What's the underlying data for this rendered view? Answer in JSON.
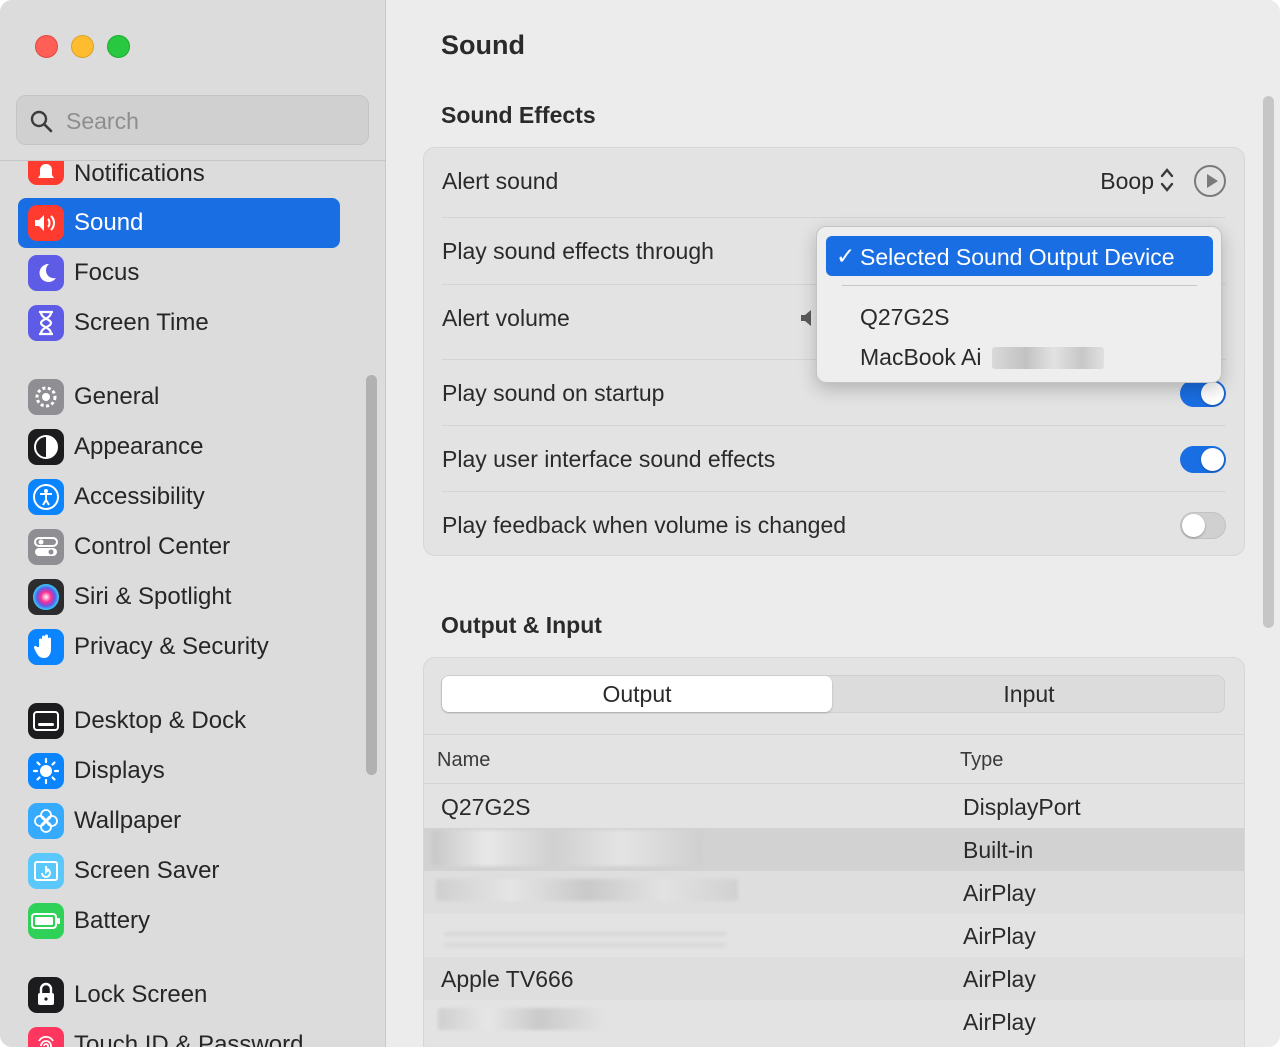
{
  "sidebar": {
    "search_placeholder": "Search",
    "items": [
      {
        "label": "Notifications",
        "icon": "bell-icon",
        "color": "#ff3b30"
      },
      {
        "label": "Sound",
        "icon": "speaker-icon",
        "color": "#ff3b30",
        "active": true
      },
      {
        "label": "Focus",
        "icon": "moon-icon",
        "color": "#5e5ce6"
      },
      {
        "label": "Screen Time",
        "icon": "hourglass-icon",
        "color": "#5e5ce6"
      },
      {
        "label": "General",
        "icon": "gear-icon",
        "color": "#8e8e93"
      },
      {
        "label": "Appearance",
        "icon": "appearance-icon",
        "color": "#1c1c1e"
      },
      {
        "label": "Accessibility",
        "icon": "accessibility-icon",
        "color": "#0a84ff"
      },
      {
        "label": "Control Center",
        "icon": "toggles-icon",
        "color": "#8e8e93"
      },
      {
        "label": "Siri & Spotlight",
        "icon": "siri-icon",
        "color": "#2c2c2e"
      },
      {
        "label": "Privacy & Security",
        "icon": "hand-icon",
        "color": "#0a84ff"
      },
      {
        "label": "Desktop & Dock",
        "icon": "dock-icon",
        "color": "#1c1c1e"
      },
      {
        "label": "Displays",
        "icon": "sun-icon",
        "color": "#0a84ff"
      },
      {
        "label": "Wallpaper",
        "icon": "flower-icon",
        "color": "#35aaff"
      },
      {
        "label": "Screen Saver",
        "icon": "screensaver-icon",
        "color": "#5ac8fa"
      },
      {
        "label": "Battery",
        "icon": "battery-icon",
        "color": "#30d158"
      },
      {
        "label": "Lock Screen",
        "icon": "lock-icon",
        "color": "#1c1c1e"
      },
      {
        "label": "Touch ID & Password",
        "icon": "fingerprint-icon",
        "color": "#ff375f"
      }
    ]
  },
  "main": {
    "title": "Sound",
    "sound_effects": {
      "heading": "Sound Effects",
      "alert_sound_label": "Alert sound",
      "alert_sound_value": "Boop",
      "play_through_label": "Play sound effects through",
      "alert_volume_label": "Alert volume",
      "startup_label": "Play sound on startup",
      "startup_on": true,
      "ui_sounds_label": "Play user interface sound effects",
      "ui_sounds_on": true,
      "feedback_label": "Play feedback when volume is changed",
      "feedback_on": false
    },
    "dropdown": {
      "check": "✓",
      "selected": "Selected Sound Output Device",
      "options": [
        "Q27G2S",
        "MacBook Ai"
      ]
    },
    "output_input": {
      "heading": "Output & Input",
      "tabs": [
        "Output",
        "Input"
      ],
      "columns": [
        "Name",
        "Type"
      ],
      "rows": [
        {
          "name": "Q27G2S",
          "type": "DisplayPort"
        },
        {
          "name": "",
          "type": "Built-in"
        },
        {
          "name": "",
          "type": "AirPlay"
        },
        {
          "name": "",
          "type": "AirPlay"
        },
        {
          "name": "Apple TV666",
          "type": "AirPlay"
        },
        {
          "name": "",
          "type": "AirPlay"
        }
      ]
    }
  }
}
